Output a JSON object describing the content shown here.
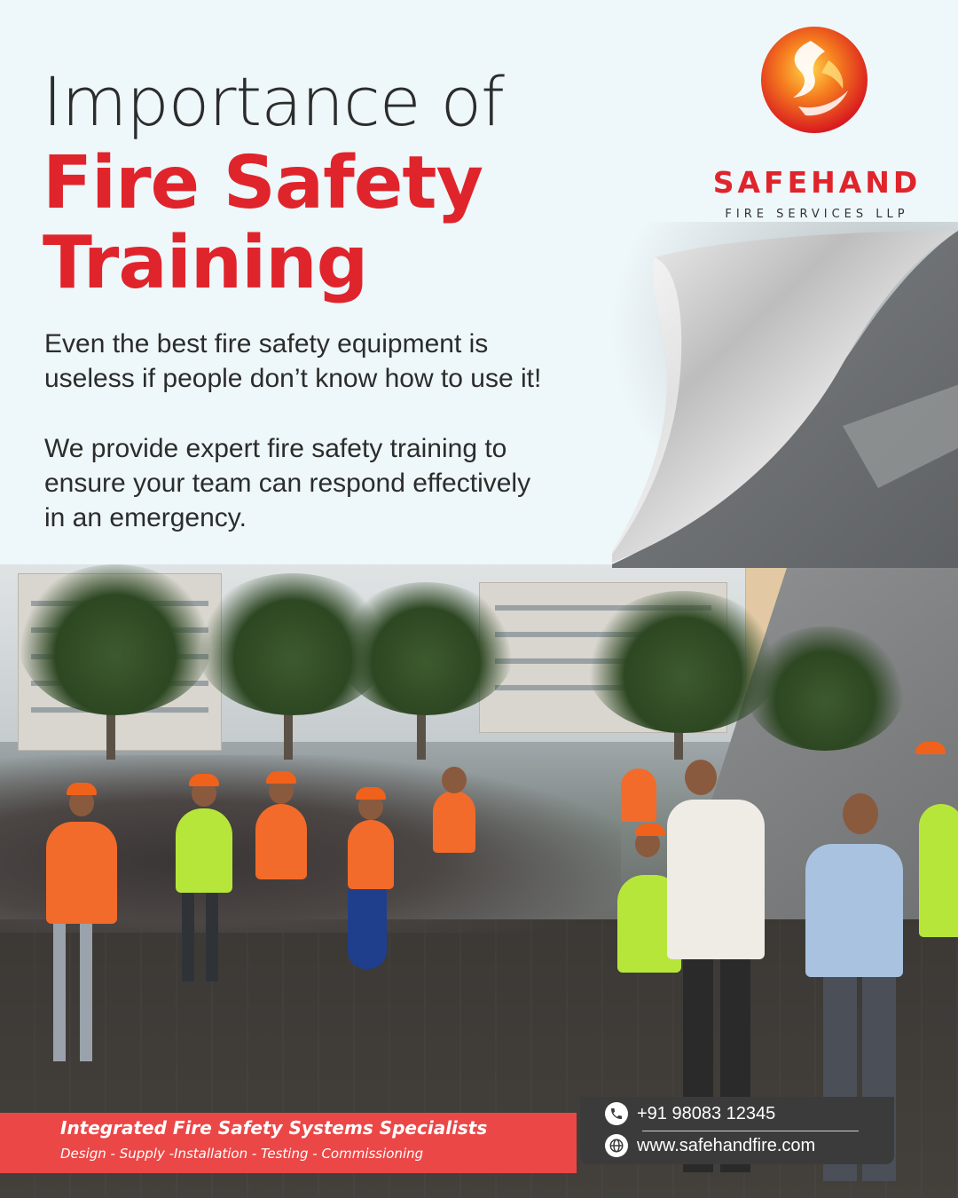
{
  "headline": {
    "line1": "Importance of",
    "line2": "Fire Safety",
    "line3": "Training"
  },
  "body": {
    "paragraph1_line1": "Even the best fire safety equipment is",
    "paragraph1_line2": "useless if people don’t know how to use it!",
    "paragraph2_line1": "We provide expert fire safety training to",
    "paragraph2_line2": "ensure your team can respond effectively",
    "paragraph2_line3": "in an emergency."
  },
  "logo": {
    "name": "SAFEHAND",
    "subtitle": "FIRE SERVICES LLP",
    "icon": "flame-swirl-logo-icon"
  },
  "footer": {
    "tagline": "Integrated Fire Safety Systems Specialists",
    "services": "Design - Supply -Installation - Testing - Commissioning"
  },
  "contact": {
    "phone": "+91 98083 12345",
    "phone_icon": "phone-icon",
    "website": "www.safehandfire.com",
    "website_icon": "globe-icon"
  },
  "colors": {
    "brand_red": "#e0242b",
    "bar_red": "#ec4747",
    "contact_bg": "#3b3b3b",
    "page_bg": "#eef7fa"
  }
}
